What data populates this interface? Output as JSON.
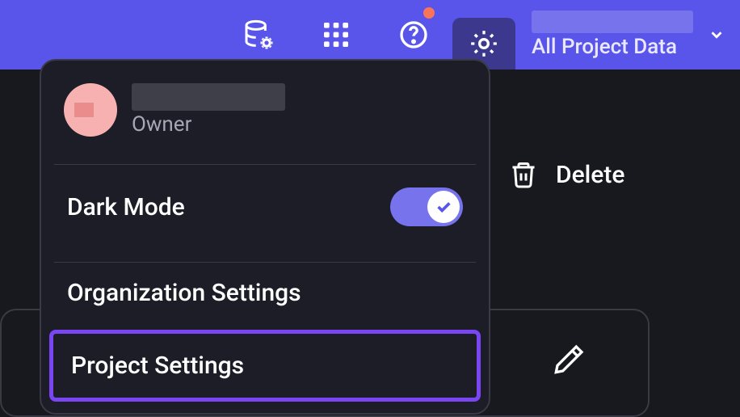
{
  "header": {
    "project_name_redacted": true,
    "project_subtitle": "All Project Data"
  },
  "actions": {
    "delete_label": "Delete"
  },
  "dropdown": {
    "user": {
      "name_redacted": true,
      "role": "Owner"
    },
    "dark_mode": {
      "label": "Dark Mode",
      "enabled": true
    },
    "items": [
      {
        "label": "Organization Settings"
      },
      {
        "label": "Project Settings"
      }
    ]
  }
}
